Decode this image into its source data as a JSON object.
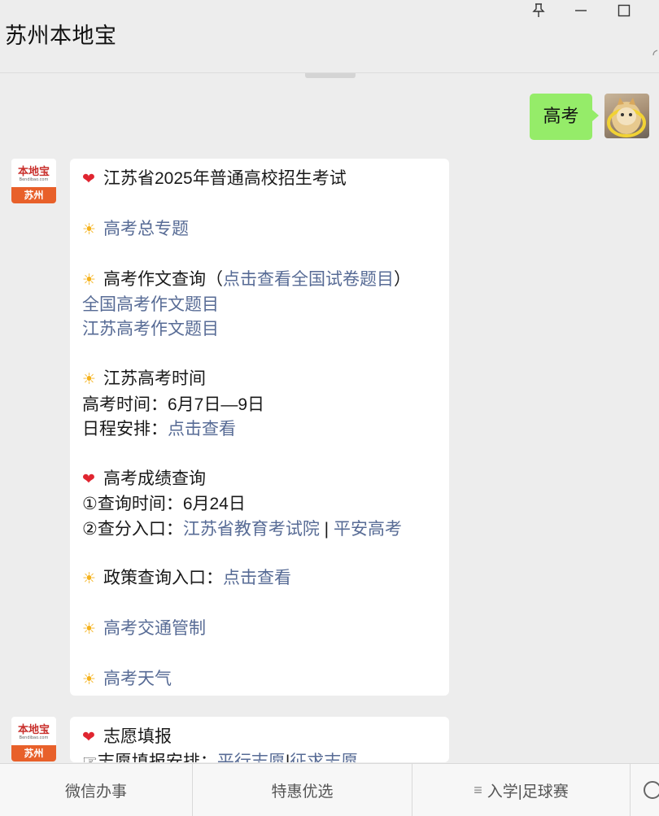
{
  "window": {
    "title": "苏州本地宝",
    "controls": [
      "pin-icon",
      "minimize-icon",
      "maximize-icon"
    ]
  },
  "messages": {
    "outgoing": {
      "text": "高考"
    },
    "incoming_1": {
      "avatar": {
        "brand": "本地宝",
        "domain": "Bendibao.com",
        "city": "苏州"
      },
      "lines": {
        "l1": "江苏省2025年普通高校招生考试",
        "l2": "高考总专题",
        "l3_prefix": "高考作文查询（",
        "l3_link": "点击查看全国试卷题目",
        "l3_suffix": "）",
        "l4": "全国高考作文题目",
        "l5": "江苏高考作文题目",
        "l6": "江苏高考时间",
        "l7": "高考时间：6月7日—9日",
        "l8_prefix": "日程安排：",
        "l8_link": "点击查看",
        "l9": "高考成绩查询",
        "l10": "①查询时间：6月24日",
        "l11_prefix": "②查分入口：",
        "l11_link1": "江苏省教育考试院",
        "l11_sep": " | ",
        "l11_link2": "平安高考",
        "l12_prefix": "政策查询入口：",
        "l12_link": "点击查看",
        "l13": "高考交通管制",
        "l14": "高考天气"
      },
      "emoji": {
        "heart": "❤",
        "sun": "☀"
      }
    },
    "incoming_2": {
      "avatar": {
        "brand": "本地宝",
        "domain": "Bendibao.com",
        "city": "苏州"
      },
      "lines": {
        "l1": "志愿填报",
        "l2_prefix": "☞志愿填报安排：",
        "l2_link1": "平行志愿",
        "l2_sep": "|",
        "l2_link2": "征求志愿"
      }
    }
  },
  "menu": {
    "tab1": "微信办事",
    "tab2": "特惠优选",
    "tab3": "入学|足球赛",
    "tab3_icon": "≡"
  },
  "colors": {
    "background": "#ededed",
    "outgoing_bubble": "#95ec69",
    "link": "#576b95",
    "heart": "#e02530",
    "sun": "#f5b21b",
    "logo_orange": "#e8602a"
  }
}
